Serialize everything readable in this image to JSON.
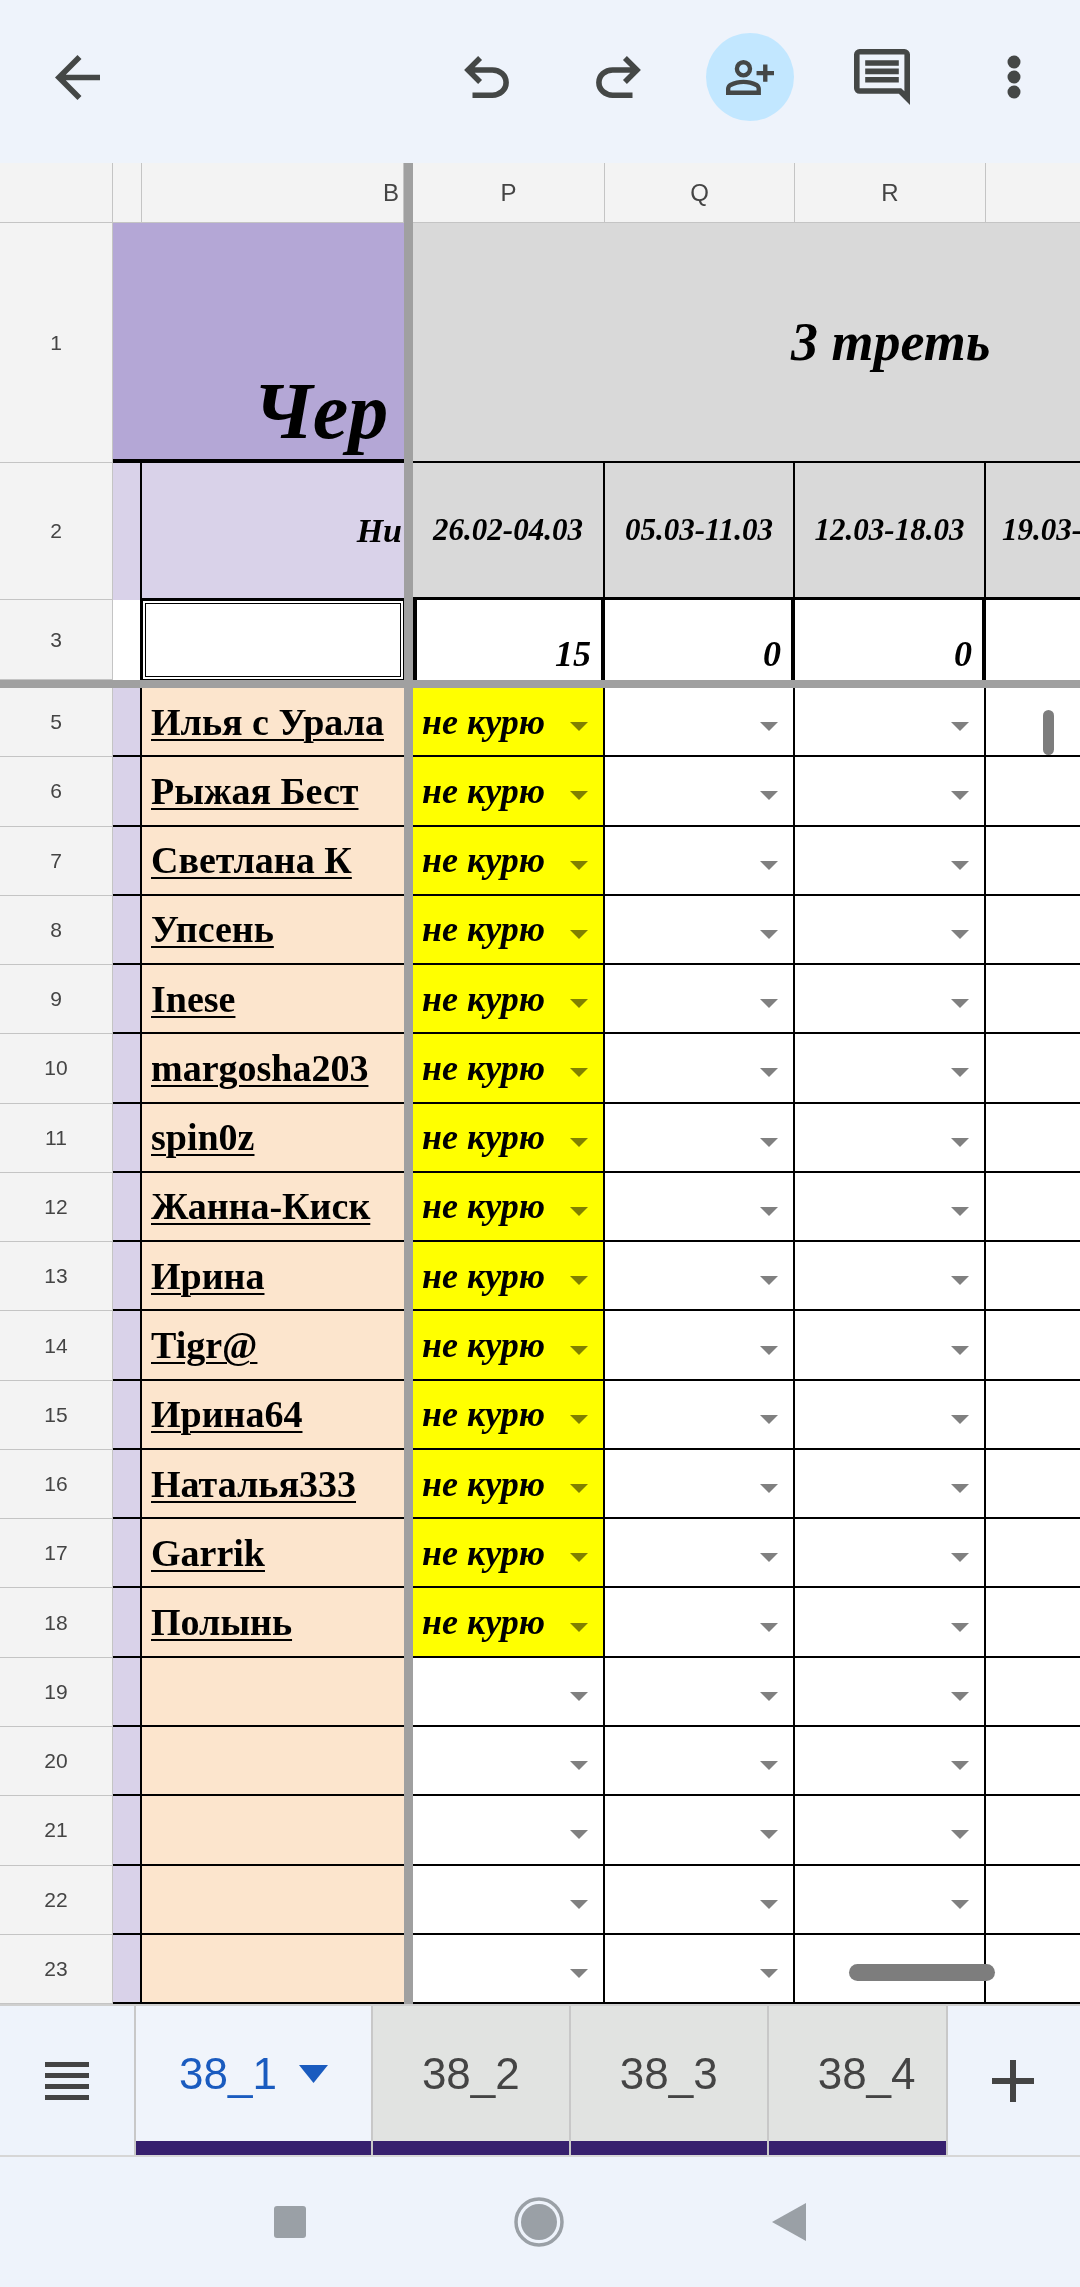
{
  "toolbar": {
    "actions": [
      {
        "highlighted": false
      },
      {
        "highlighted": false
      },
      {
        "highlighted": true
      },
      {
        "highlighted": false
      },
      {
        "highlighted": false
      }
    ]
  },
  "column_headers": [
    "B",
    "P",
    "Q",
    "R"
  ],
  "row_1": {
    "number": "1",
    "title": "Чер",
    "section_title": "3 треть"
  },
  "row_2": {
    "number": "2",
    "name_header": "Ни",
    "weeks": [
      "26.02-04.03",
      "05.03-11.03",
      "12.03-18.03",
      "19.03-"
    ]
  },
  "row_3": {
    "number": "3",
    "totals": [
      "15",
      "0",
      "0"
    ]
  },
  "rows": [
    {
      "number": "5",
      "name": "Илья с Урала",
      "cells": [
        {
          "text": "не курю",
          "color": "#ffff00"
        },
        {
          "color": "#ffffff"
        },
        {
          "color": "#ffffff"
        }
      ]
    },
    {
      "number": "6",
      "name": "Рыжая Бест",
      "cells": [
        {
          "text": "не курю",
          "color": "#ffff00"
        },
        {
          "color": "#ffffff"
        },
        {
          "color": "#ffffff"
        }
      ]
    },
    {
      "number": "7",
      "name": "Светлана К",
      "cells": [
        {
          "text": "не курю",
          "color": "#ffff00"
        },
        {
          "color": "#ffffff"
        },
        {
          "color": "#ffffff"
        }
      ]
    },
    {
      "number": "8",
      "name": "Упсень",
      "cells": [
        {
          "text": "не курю",
          "color": "#ffff00"
        },
        {
          "color": "#ffffff"
        },
        {
          "color": "#ffffff"
        }
      ]
    },
    {
      "number": "9",
      "name": "Inese",
      "cells": [
        {
          "text": "не курю",
          "color": "#ffff00"
        },
        {
          "color": "#ffffff"
        },
        {
          "color": "#ffffff"
        }
      ]
    },
    {
      "number": "10",
      "name": "margosha203",
      "cells": [
        {
          "text": "не курю",
          "color": "#ffff00"
        },
        {
          "color": "#ffffff"
        },
        {
          "color": "#ffffff"
        }
      ]
    },
    {
      "number": "11",
      "name": "spin0z",
      "cells": [
        {
          "text": "не курю",
          "color": "#ffff00"
        },
        {
          "color": "#ffffff"
        },
        {
          "color": "#ffffff"
        }
      ]
    },
    {
      "number": "12",
      "name": "Жанна-Киск",
      "cells": [
        {
          "text": "не курю",
          "color": "#ffff00"
        },
        {
          "color": "#ffffff"
        },
        {
          "color": "#ffffff"
        }
      ]
    },
    {
      "number": "13",
      "name": "Ирина",
      "cells": [
        {
          "text": "не курю",
          "color": "#ffff00"
        },
        {
          "color": "#ffffff"
        },
        {
          "color": "#ffffff"
        }
      ]
    },
    {
      "number": "14",
      "name": "Tigr@",
      "cells": [
        {
          "text": "не курю",
          "color": "#ffff00"
        },
        {
          "color": "#ffffff"
        },
        {
          "color": "#ffffff"
        }
      ]
    },
    {
      "number": "15",
      "name": "Ирина64",
      "cells": [
        {
          "text": "не курю",
          "color": "#ffff00"
        },
        {
          "color": "#ffffff"
        },
        {
          "color": "#ffffff"
        }
      ]
    },
    {
      "number": "16",
      "name": "Наталья333",
      "cells": [
        {
          "text": "не курю",
          "color": "#ffff00"
        },
        {
          "color": "#ffffff"
        },
        {
          "color": "#ffffff"
        }
      ]
    },
    {
      "number": "17",
      "name": "Garrik",
      "cells": [
        {
          "text": "не курю",
          "color": "#ffff00"
        },
        {
          "color": "#ffffff"
        },
        {
          "color": "#ffffff"
        }
      ]
    },
    {
      "number": "18",
      "name": "Полынь",
      "cells": [
        {
          "text": "не курю",
          "color": "#ffff00"
        },
        {
          "color": "#ffffff"
        },
        {
          "color": "#ffffff"
        }
      ]
    },
    {
      "number": "19",
      "cells": [
        {
          "color": "#ffffff"
        },
        {
          "color": "#ffffff"
        },
        {
          "color": "#ffffff"
        }
      ]
    },
    {
      "number": "20",
      "cells": [
        {
          "color": "#ffffff"
        },
        {
          "color": "#ffffff"
        },
        {
          "color": "#ffffff"
        }
      ]
    },
    {
      "number": "21",
      "cells": [
        {
          "color": "#ffffff"
        },
        {
          "color": "#ffffff"
        },
        {
          "color": "#ffffff"
        }
      ]
    },
    {
      "number": "22",
      "cells": [
        {
          "color": "#ffffff"
        },
        {
          "color": "#ffffff"
        },
        {
          "color": "#ffffff"
        }
      ]
    },
    {
      "number": "23",
      "cells": [
        {
          "color": "#ffffff"
        },
        {
          "color": "#ffffff"
        },
        {
          "color": "#ffffff"
        }
      ]
    }
  ],
  "sheet_tabs": [
    {
      "label": "38_1",
      "selected": true,
      "color": "#37206e"
    },
    {
      "label": "38_2",
      "selected": false,
      "color": "#37206e"
    },
    {
      "label": "38_3",
      "selected": false,
      "color": "#37206e"
    },
    {
      "label": "38_4",
      "selected": false,
      "color": "#37206e"
    }
  ]
}
